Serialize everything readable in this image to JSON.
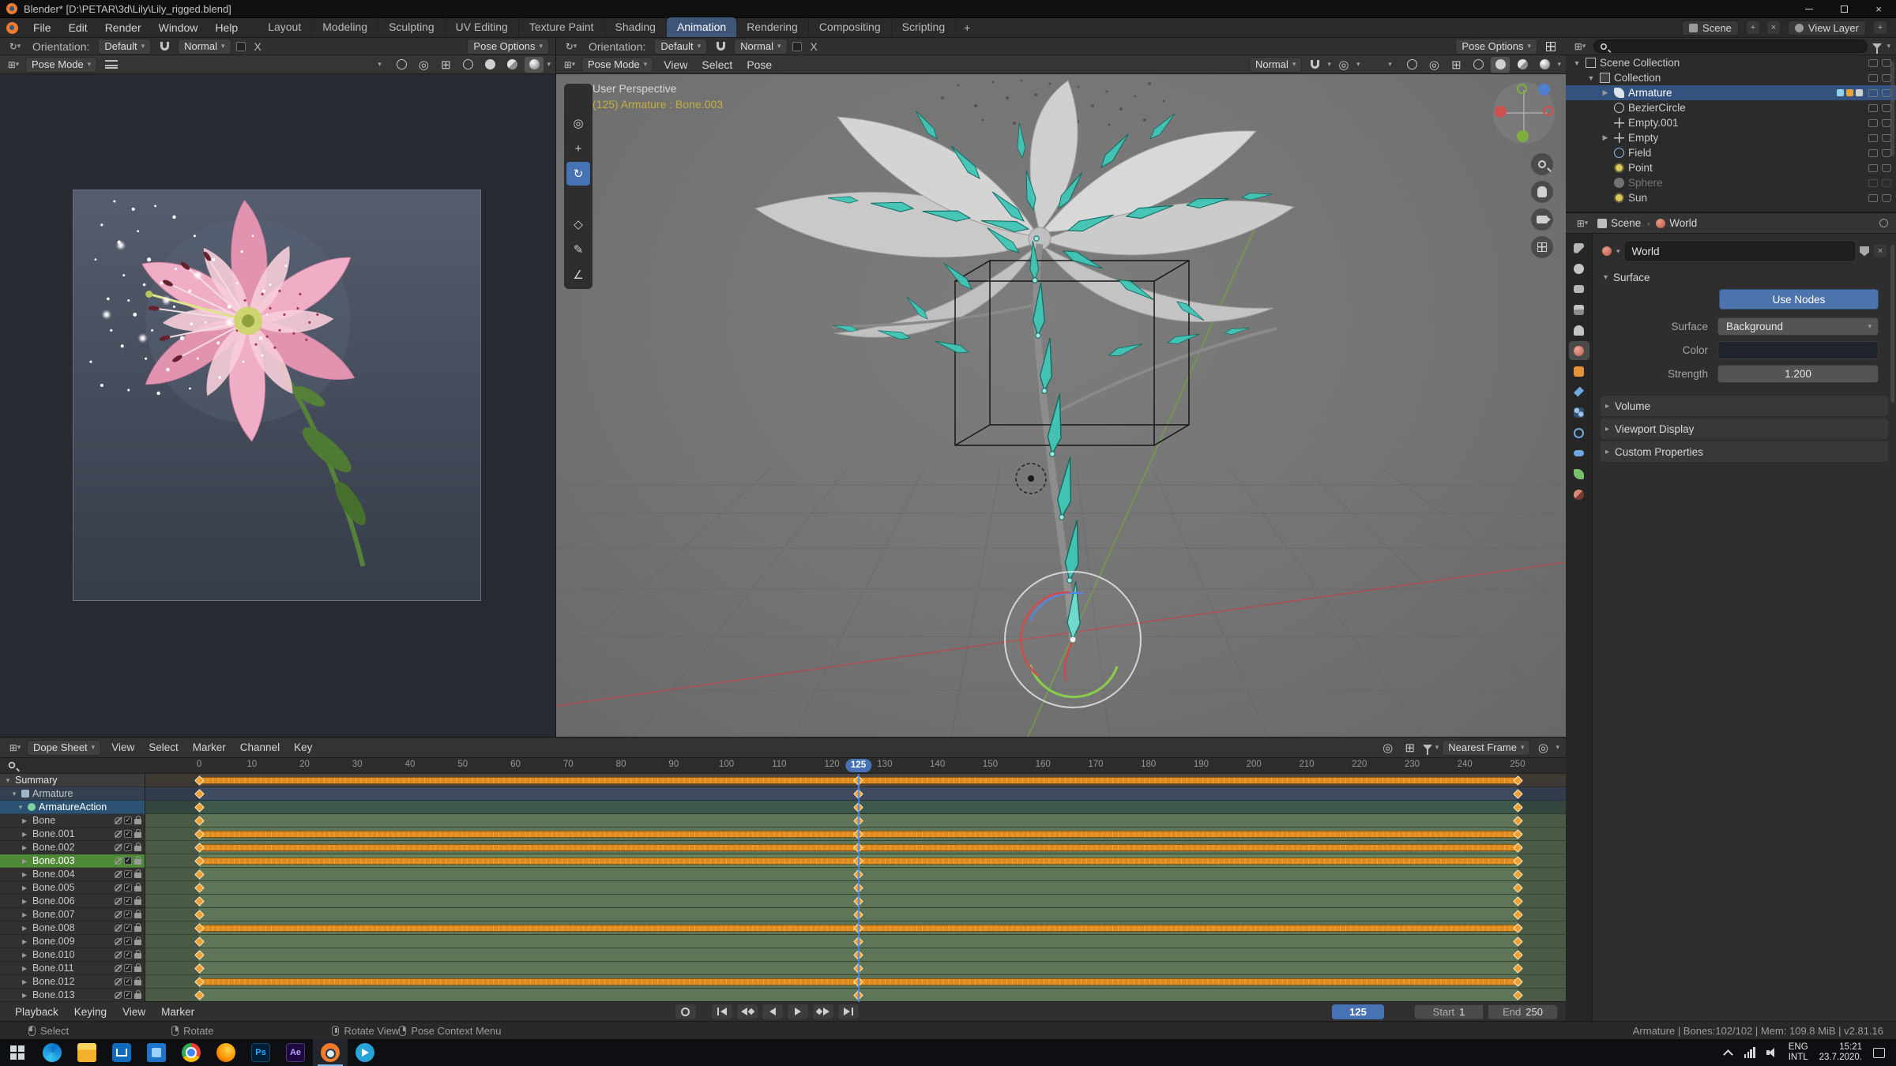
{
  "window": {
    "title": "Blender* [D:\\PETAR\\3d\\Lily\\Lily_rigged.blend]"
  },
  "topbar": {
    "menus": [
      {
        "label": "File"
      },
      {
        "label": "Edit"
      },
      {
        "label": "Render"
      },
      {
        "label": "Window"
      },
      {
        "label": "Help"
      }
    ],
    "workspaces": [
      {
        "label": "Layout"
      },
      {
        "label": "Modeling"
      },
      {
        "label": "Sculpting"
      },
      {
        "label": "UV Editing"
      },
      {
        "label": "Texture Paint"
      },
      {
        "label": "Shading"
      },
      {
        "label": "Animation",
        "cls": "active"
      },
      {
        "label": "Rendering"
      },
      {
        "label": "Compositing"
      },
      {
        "label": "Scripting"
      }
    ],
    "add_tab": "+",
    "scene_label": "Scene",
    "view_layer_label": "View Layer"
  },
  "tools_left": {
    "orientation_label": "Orientation:",
    "orientation_value": "Default",
    "snap_value": "Normal",
    "mirror_label": "X",
    "pose_options": "Pose Options"
  },
  "tools_main": {
    "orientation_label": "Orientation:",
    "orientation_value": "Default",
    "snap_value": "Normal",
    "mirror_label": "X",
    "pose_options": "Pose Options"
  },
  "viewport_left": {
    "mode": "Pose Mode"
  },
  "viewport_main": {
    "mode": "Pose Mode",
    "menus": [
      {
        "label": "View"
      },
      {
        "label": "Select"
      },
      {
        "label": "Pose"
      }
    ],
    "orientation": "Normal",
    "overlay_perspective": "User Perspective",
    "overlay_active": "(125) Armature : Bone.003",
    "tools": [
      {
        "cls": "t-select"
      },
      {
        "cls": "t-cursor",
        "g": "◎"
      },
      {
        "cls": "t-move",
        "g": "+"
      },
      {
        "cls": "t-rotate active",
        "g": "↻"
      },
      {
        "cls": "t-scale"
      },
      {
        "cls": "t-transform",
        "g": "◇"
      },
      {
        "cls": "t-annotate",
        "g": "✎"
      },
      {
        "cls": "t-measure",
        "g": "∠"
      }
    ]
  },
  "outliner": {
    "items": [
      {
        "label": "Scene Collection",
        "cls": "d0",
        "icon": "scene-collection",
        "tri": "▼"
      },
      {
        "label": "Collection",
        "cls": "d1",
        "icon": "collection",
        "tri": "▼"
      },
      {
        "label": "Armature",
        "cls": "d2 sel",
        "icon": "armature",
        "tri": "▶"
      },
      {
        "label": "BezierCircle",
        "cls": "d2",
        "icon": "curve",
        "tri": ""
      },
      {
        "label": "Empty.001",
        "cls": "d2",
        "icon": "empty",
        "tri": ""
      },
      {
        "label": "Empty",
        "cls": "d2",
        "icon": "empty",
        "tri": "▶"
      },
      {
        "label": "Field",
        "cls": "d2",
        "icon": "field",
        "tri": ""
      },
      {
        "label": "Point",
        "cls": "d2",
        "icon": "light",
        "tri": ""
      },
      {
        "label": "Sphere",
        "cls": "d2 dim",
        "icon": "mesh",
        "tri": ""
      },
      {
        "label": "Sun",
        "cls": "d2",
        "icon": "light",
        "tri": ""
      }
    ]
  },
  "properties": {
    "tabs": [
      {
        "cls": "pt-tool"
      },
      {
        "cls": "pt-render"
      },
      {
        "cls": "pt-output"
      },
      {
        "cls": "pt-viewlayer"
      },
      {
        "cls": "pt-scene"
      },
      {
        "cls": "pt-world active"
      },
      {
        "cls": "pt-object"
      },
      {
        "cls": "pt-modifiers"
      },
      {
        "cls": "pt-particles"
      },
      {
        "cls": "pt-physics"
      },
      {
        "cls": "pt-constraints"
      },
      {
        "cls": "pt-data"
      },
      {
        "cls": "pt-material"
      }
    ],
    "breadcrumb_scene": "Scene",
    "breadcrumb_world": "World",
    "world_name": "World",
    "surface_section": "Surface",
    "use_nodes": "Use Nodes",
    "surface_label": "Surface",
    "surface_value": "Background",
    "color_label": "Color",
    "strength_label": "Strength",
    "strength_value": "1.200",
    "collapsed": [
      {
        "label": "Volume"
      },
      {
        "label": "Viewport Display"
      },
      {
        "label": "Custom Properties"
      }
    ]
  },
  "dopesheet": {
    "editor": "Dope Sheet",
    "menus": [
      {
        "label": "View"
      },
      {
        "label": "Select"
      },
      {
        "label": "Marker"
      },
      {
        "label": "Channel"
      },
      {
        "label": "Key"
      }
    ],
    "snap": "Nearest Frame",
    "current_frame": 125,
    "frame_range": [
      0,
      250
    ],
    "key_frames": [
      0,
      125,
      250
    ],
    "ruler_ticks": [
      0,
      10,
      20,
      30,
      40,
      50,
      60,
      70,
      80,
      90,
      100,
      110,
      120,
      130,
      140,
      150,
      160,
      170,
      180,
      190,
      200,
      210,
      220,
      230,
      240,
      250
    ],
    "channels": [
      {
        "name": "Summary",
        "kind": "summary",
        "cls": "summary",
        "tri": "▼"
      },
      {
        "name": "Armature",
        "kind": "object",
        "cls": "object",
        "tri": "▼"
      },
      {
        "name": "ArmatureAction",
        "kind": "action",
        "cls": "action",
        "tri": "▼"
      },
      {
        "name": "Bone",
        "kind": "bone",
        "cls": "bone",
        "tri": "▶"
      },
      {
        "name": "Bone.001",
        "kind": "bone",
        "cls": "bone",
        "tri": "▶",
        "baked": true
      },
      {
        "name": "Bone.002",
        "kind": "bone",
        "cls": "bone",
        "tri": "▶",
        "baked": true
      },
      {
        "name": "Bone.003",
        "kind": "bone",
        "cls": "bone bsel",
        "tri": "▶",
        "baked": true,
        "selected": true
      },
      {
        "name": "Bone.004",
        "kind": "bone",
        "cls": "bone",
        "tri": "▶"
      },
      {
        "name": "Bone.005",
        "kind": "bone",
        "cls": "bone",
        "tri": "▶"
      },
      {
        "name": "Bone.006",
        "kind": "bone",
        "cls": "bone",
        "tri": "▶"
      },
      {
        "name": "Bone.007",
        "kind": "bone",
        "cls": "bone",
        "tri": "▶"
      },
      {
        "name": "Bone.008",
        "kind": "bone",
        "cls": "bone",
        "tri": "▶",
        "baked": true
      },
      {
        "name": "Bone.009",
        "kind": "bone",
        "cls": "bone",
        "tri": "▶"
      },
      {
        "name": "Bone.010",
        "kind": "bone",
        "cls": "bone",
        "tri": "▶"
      },
      {
        "name": "Bone.011",
        "kind": "bone",
        "cls": "bone",
        "tri": "▶"
      },
      {
        "name": "Bone.012",
        "kind": "bone",
        "cls": "bone",
        "tri": "▶",
        "baked": true
      },
      {
        "name": "Bone.013",
        "kind": "bone",
        "cls": "bone",
        "tri": "▶"
      }
    ],
    "playback": {
      "menus": [
        {
          "label": "Playback"
        },
        {
          "label": "Keying"
        },
        {
          "label": "View"
        },
        {
          "label": "Marker"
        }
      ],
      "frame": "125",
      "start_label": "Start",
      "start_value": "1",
      "end_label": "End",
      "end_value": "250"
    }
  },
  "statusbar": {
    "hints": [
      {
        "label": "Select",
        "btn": "l"
      },
      {
        "label": "Rotate",
        "btn": "r"
      },
      {
        "label": "Rotate View",
        "btn": "m"
      },
      {
        "label": "Pose Context Menu",
        "btn": "r"
      }
    ],
    "info": "Armature | Bones:102/102 | Mem: 109.8 MiB | v2.81.16"
  },
  "taskbar": {
    "apps": [
      {
        "cls": "edge"
      },
      {
        "cls": "explorer"
      },
      {
        "cls": "store"
      },
      {
        "cls": "photos"
      },
      {
        "cls": "chrome"
      },
      {
        "cls": "firefox"
      },
      {
        "cls": "photoshop",
        "label": "Ps"
      },
      {
        "cls": "after-effects",
        "label": "Ae"
      },
      {
        "cls": "blender",
        "active": "active"
      },
      {
        "cls": "telegram"
      }
    ],
    "lang_top": "ENG",
    "lang_bottom": "INTL",
    "time": "15:21",
    "date": "23.7.2020."
  }
}
